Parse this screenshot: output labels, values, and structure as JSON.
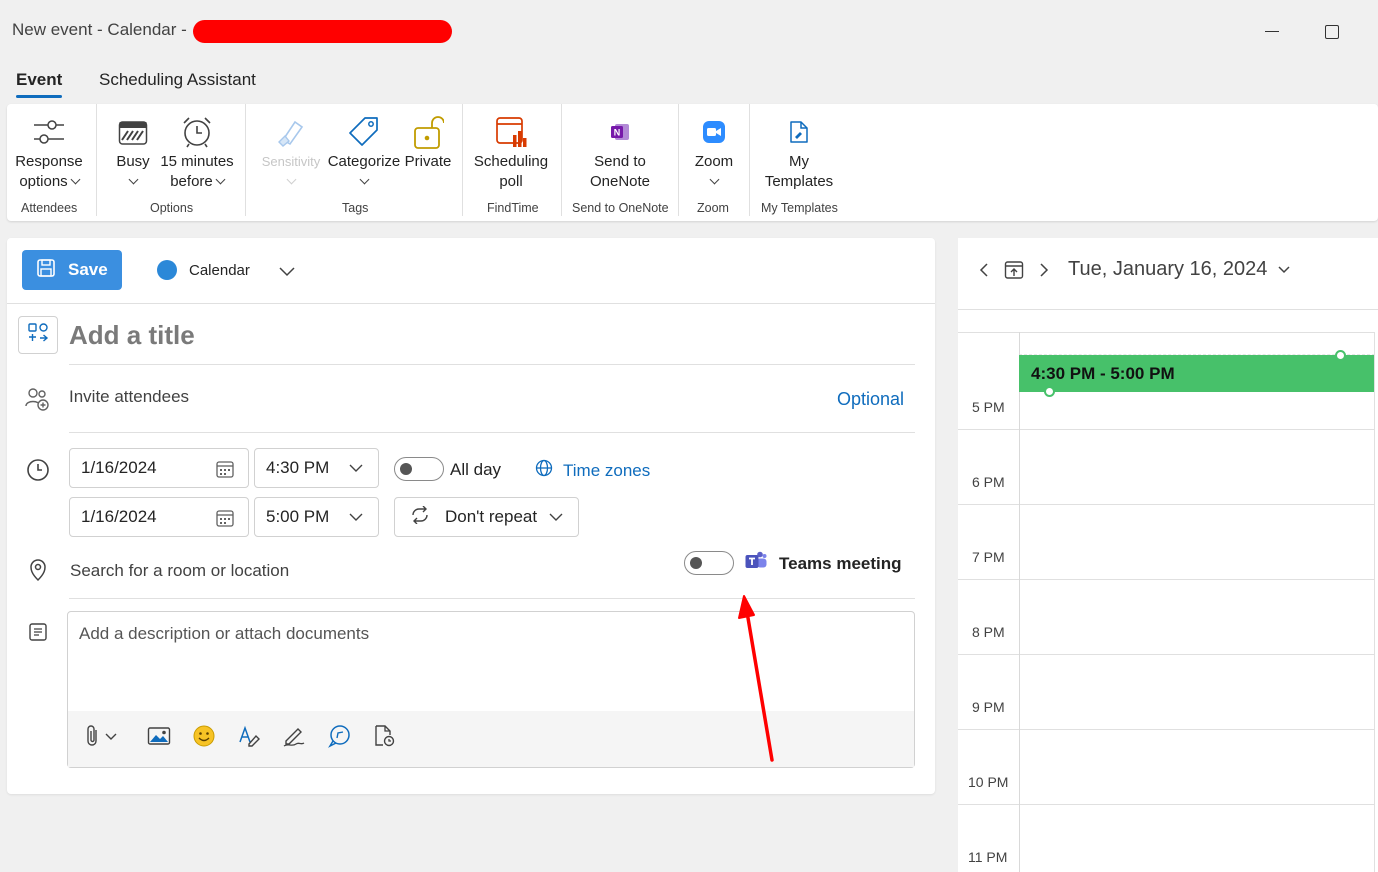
{
  "window": {
    "title": "New event - Calendar - ",
    "redaction_color": "#ff0000"
  },
  "tabs": [
    {
      "label": "Event",
      "active": true
    },
    {
      "label": "Scheduling Assistant",
      "active": false
    }
  ],
  "ribbon": {
    "response_options": {
      "line1": "Response",
      "line2": "options"
    },
    "busy": {
      "label": "Busy"
    },
    "reminder": {
      "line1": "15 minutes",
      "line2": "before"
    },
    "sensitivity": {
      "label": "Sensitivity",
      "disabled": true
    },
    "categorize": {
      "label": "Categorize"
    },
    "private": {
      "label": "Private"
    },
    "scheduling_poll": {
      "line1": "Scheduling",
      "line2": "poll"
    },
    "onenote": {
      "line1": "Send to",
      "line2": "OneNote"
    },
    "zoom": {
      "label": "Zoom"
    },
    "templates": {
      "line1": "My",
      "line2": "Templates"
    },
    "groups": {
      "attendees": "Attendees",
      "options": "Options",
      "tags": "Tags",
      "findtime": "FindTime",
      "send_to_onenote": "Send to OneNote",
      "zoom": "Zoom",
      "my_templates": "My Templates"
    }
  },
  "form": {
    "save_label": "Save",
    "calendar_name": "Calendar",
    "calendar_color": "#2b88d8",
    "title_placeholder": "Add a title",
    "attendees_placeholder": "Invite attendees",
    "optional_label": "Optional",
    "start_date": "1/16/2024",
    "start_time": "4:30 PM",
    "end_date": "1/16/2024",
    "end_time": "5:00 PM",
    "all_day_label": "All day",
    "all_day_on": false,
    "time_zones_label": "Time zones",
    "repeat_label": "Don't repeat",
    "location_placeholder": "Search for a room or location",
    "teams_label": "Teams meeting",
    "teams_on": false,
    "description_placeholder": "Add a description or attach documents"
  },
  "day_view": {
    "date_label": "Tue, January 16, 2024",
    "hours": [
      "5 PM",
      "6 PM",
      "7 PM",
      "8 PM",
      "9 PM",
      "10 PM",
      "11 PM"
    ],
    "event": {
      "time_label": "4:30 PM - 5:00 PM",
      "color": "#47c16a"
    }
  },
  "annotation": {
    "arrow_color": "#ff0000"
  }
}
